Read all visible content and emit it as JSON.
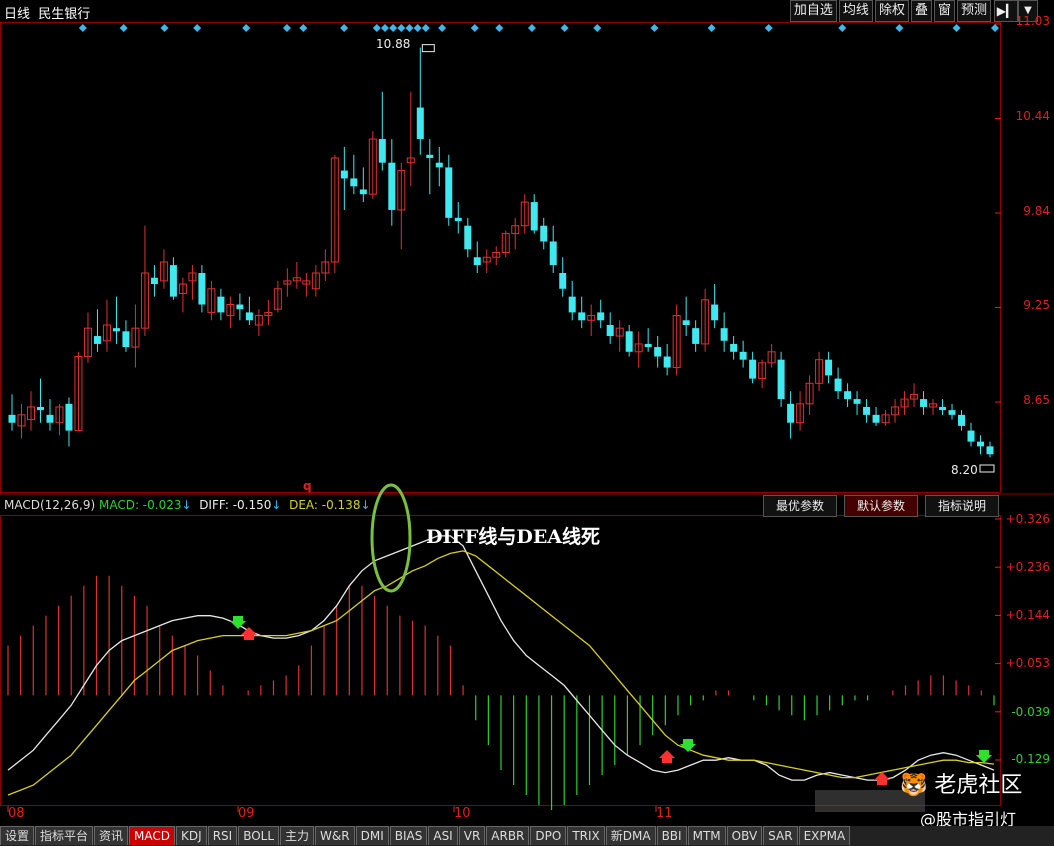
{
  "window": {
    "period": "日线",
    "stock_name": "民生银行"
  },
  "toolbar": {
    "buttons": [
      "加自选",
      "均线",
      "除权",
      "叠",
      "窗",
      "预测"
    ],
    "more_icon": "exit-icon",
    "dropdown_icon": "dropdown-arrow-icon"
  },
  "price_axis": [
    "11.03",
    "10.44",
    "9.84",
    "9.25",
    "8.65"
  ],
  "price_markers": {
    "high": "10.88",
    "low": "8.20"
  },
  "macd_panel": {
    "indicator": "MACD(12,26,9)",
    "macd_label": "MACD: -0.023",
    "diff_label": "DIFF: -0.150",
    "dea_label": "DEA: -0.138",
    "arrow_down": "↓",
    "param_tabs": [
      "最优参数",
      "默认参数",
      "指标说明"
    ],
    "active_param_tab": "默认参数",
    "axis": [
      "+0.326",
      "+0.236",
      "+0.144",
      "+0.053",
      "-0.039",
      "-0.129"
    ],
    "annotation": "DIFF线与DEA线死",
    "mark_q": "q"
  },
  "months": [
    "08",
    "09",
    "10",
    "11"
  ],
  "bottom_tabs": [
    "设置",
    "指标平台",
    "资讯",
    "MACD",
    "KDJ",
    "RSI",
    "BOLL",
    "主力",
    "W&R",
    "DMI",
    "BIAS",
    "ASI",
    "VR",
    "ARBR",
    "DPO",
    "TRIX",
    "新DMA",
    "BBI",
    "MTM",
    "OBV",
    "SAR",
    "EXPMA"
  ],
  "active_bottom_tab": "MACD",
  "watermark": {
    "brand": "老虎社区",
    "handle": "@股市指引灯"
  },
  "colors": {
    "up": "#e03030",
    "down": "#40e8f0",
    "diff_line": "#e8e8e8",
    "dea_line": "#d8d020",
    "axis_red": "#e02020",
    "signal_marker": "#3fb8e8",
    "hist_negative": "#30d030",
    "circle": "#7ac040"
  },
  "chart_data": [
    {
      "type": "candlestick",
      "title": "民生银行 日线",
      "ylim": [
        8.2,
        11.03
      ],
      "high_label": 10.88,
      "low_label": 8.2,
      "candles": [
        [
          8.55,
          8.68,
          8.45,
          8.5
        ],
        [
          8.48,
          8.62,
          8.4,
          8.55
        ],
        [
          8.52,
          8.7,
          8.45,
          8.6
        ],
        [
          8.6,
          8.78,
          8.5,
          8.58
        ],
        [
          8.55,
          8.65,
          8.45,
          8.5
        ],
        [
          8.5,
          8.62,
          8.42,
          8.6
        ],
        [
          8.62,
          8.66,
          8.35,
          8.45
        ],
        [
          8.45,
          8.95,
          8.45,
          8.92
        ],
        [
          8.92,
          9.2,
          8.88,
          9.1
        ],
        [
          9.05,
          9.22,
          8.95,
          9.0
        ],
        [
          9.02,
          9.28,
          8.95,
          9.12
        ],
        [
          9.1,
          9.3,
          9.0,
          9.08
        ],
        [
          9.08,
          9.15,
          8.95,
          8.98
        ],
        [
          8.98,
          9.25,
          8.85,
          9.1
        ],
        [
          9.1,
          9.75,
          9.05,
          9.45
        ],
        [
          9.42,
          9.5,
          9.3,
          9.38
        ],
        [
          9.4,
          9.6,
          9.35,
          9.52
        ],
        [
          9.5,
          9.55,
          9.28,
          9.3
        ],
        [
          9.32,
          9.42,
          9.2,
          9.38
        ],
        [
          9.4,
          9.5,
          9.28,
          9.45
        ],
        [
          9.45,
          9.5,
          9.2,
          9.25
        ],
        [
          9.2,
          9.4,
          9.15,
          9.35
        ],
        [
          9.3,
          9.35,
          9.15,
          9.2
        ],
        [
          9.18,
          9.3,
          9.1,
          9.25
        ],
        [
          9.25,
          9.32,
          9.15,
          9.22
        ],
        [
          9.2,
          9.3,
          9.12,
          9.15
        ],
        [
          9.12,
          9.22,
          9.05,
          9.18
        ],
        [
          9.18,
          9.28,
          9.12,
          9.2
        ],
        [
          9.22,
          9.4,
          9.2,
          9.35
        ],
        [
          9.38,
          9.48,
          9.3,
          9.4
        ],
        [
          9.4,
          9.52,
          9.35,
          9.42
        ],
        [
          9.38,
          9.45,
          9.3,
          9.4
        ],
        [
          9.35,
          9.5,
          9.3,
          9.45
        ],
        [
          9.45,
          9.6,
          9.4,
          9.52
        ],
        [
          9.52,
          10.2,
          9.45,
          10.18
        ],
        [
          10.1,
          10.25,
          9.85,
          10.05
        ],
        [
          10.05,
          10.2,
          9.95,
          10.0
        ],
        [
          9.98,
          10.12,
          9.9,
          9.95
        ],
        [
          9.95,
          10.35,
          9.92,
          10.3
        ],
        [
          10.3,
          10.6,
          10.1,
          10.15
        ],
        [
          10.15,
          10.3,
          9.75,
          9.85
        ],
        [
          9.85,
          10.15,
          9.6,
          10.1
        ],
        [
          10.15,
          10.6,
          10.0,
          10.18
        ],
        [
          10.5,
          10.88,
          10.2,
          10.3
        ],
        [
          10.2,
          10.3,
          9.95,
          10.18
        ],
        [
          10.15,
          10.25,
          10.0,
          10.12
        ],
        [
          10.12,
          10.2,
          9.75,
          9.8
        ],
        [
          9.8,
          9.9,
          9.7,
          9.78
        ],
        [
          9.75,
          9.8,
          9.55,
          9.6
        ],
        [
          9.55,
          9.65,
          9.45,
          9.5
        ],
        [
          9.52,
          9.6,
          9.45,
          9.55
        ],
        [
          9.55,
          9.62,
          9.5,
          9.58
        ],
        [
          9.58,
          9.72,
          9.55,
          9.7
        ],
        [
          9.7,
          9.8,
          9.6,
          9.75
        ],
        [
          9.75,
          9.95,
          9.7,
          9.9
        ],
        [
          9.9,
          9.95,
          9.7,
          9.72
        ],
        [
          9.75,
          9.8,
          9.6,
          9.65
        ],
        [
          9.65,
          9.75,
          9.45,
          9.5
        ],
        [
          9.45,
          9.55,
          9.3,
          9.35
        ],
        [
          9.3,
          9.4,
          9.15,
          9.2
        ],
        [
          9.2,
          9.3,
          9.1,
          9.15
        ],
        [
          9.15,
          9.25,
          9.05,
          9.18
        ],
        [
          9.2,
          9.28,
          9.1,
          9.15
        ],
        [
          9.12,
          9.2,
          9.0,
          9.05
        ],
        [
          9.05,
          9.15,
          8.95,
          9.1
        ],
        [
          9.08,
          9.12,
          8.92,
          8.95
        ],
        [
          8.95,
          9.08,
          8.85,
          9.0
        ],
        [
          9.0,
          9.1,
          8.95,
          8.98
        ],
        [
          8.98,
          9.05,
          8.85,
          8.92
        ],
        [
          8.92,
          9.0,
          8.8,
          8.85
        ],
        [
          8.85,
          9.25,
          8.8,
          9.18
        ],
        [
          9.15,
          9.3,
          9.05,
          9.12
        ],
        [
          9.1,
          9.15,
          8.95,
          9.0
        ],
        [
          9.0,
          9.35,
          8.95,
          9.28
        ],
        [
          9.25,
          9.38,
          9.1,
          9.15
        ],
        [
          9.1,
          9.2,
          8.95,
          9.02
        ],
        [
          9.0,
          9.05,
          8.9,
          8.95
        ],
        [
          8.95,
          9.02,
          8.85,
          8.9
        ],
        [
          8.9,
          8.95,
          8.75,
          8.78
        ],
        [
          8.78,
          8.9,
          8.72,
          8.88
        ],
        [
          8.88,
          9.0,
          8.85,
          8.95
        ],
        [
          8.9,
          8.95,
          8.6,
          8.65
        ],
        [
          8.62,
          8.7,
          8.4,
          8.5
        ],
        [
          8.5,
          8.7,
          8.45,
          8.62
        ],
        [
          8.62,
          8.8,
          8.55,
          8.75
        ],
        [
          8.75,
          8.95,
          8.7,
          8.9
        ],
        [
          8.9,
          8.95,
          8.75,
          8.8
        ],
        [
          8.78,
          8.85,
          8.65,
          8.7
        ],
        [
          8.7,
          8.75,
          8.6,
          8.65
        ],
        [
          8.65,
          8.7,
          8.55,
          8.62
        ],
        [
          8.6,
          8.65,
          8.5,
          8.55
        ],
        [
          8.55,
          8.6,
          8.48,
          8.5
        ],
        [
          8.5,
          8.58,
          8.48,
          8.55
        ],
        [
          8.55,
          8.65,
          8.5,
          8.6
        ],
        [
          8.6,
          8.7,
          8.55,
          8.65
        ],
        [
          8.65,
          8.75,
          8.6,
          8.68
        ],
        [
          8.65,
          8.7,
          8.55,
          8.6
        ],
        [
          8.6,
          8.65,
          8.55,
          8.62
        ],
        [
          8.6,
          8.65,
          8.55,
          8.58
        ],
        [
          8.58,
          8.62,
          8.52,
          8.55
        ],
        [
          8.55,
          8.58,
          8.45,
          8.48
        ],
        [
          8.45,
          8.5,
          8.35,
          8.38
        ],
        [
          8.38,
          8.42,
          8.3,
          8.35
        ],
        [
          8.35,
          8.38,
          8.28,
          8.3
        ]
      ],
      "signal_markers_top": [
        5,
        10,
        15,
        19,
        25,
        30,
        32,
        37,
        41,
        42,
        43,
        44,
        45,
        46,
        47,
        49,
        53,
        56,
        60,
        64,
        68,
        75,
        82,
        89,
        98,
        105,
        112
      ]
    },
    {
      "type": "line",
      "title": "MACD(12,26,9)",
      "ylim": [
        -0.22,
        0.36
      ],
      "axis_ticks": [
        0.326,
        0.236,
        0.144,
        0.053,
        -0.039,
        -0.129
      ],
      "series": [
        {
          "name": "DIFF",
          "values": [
            -0.15,
            -0.13,
            -0.11,
            -0.08,
            -0.05,
            -0.02,
            0.02,
            0.06,
            0.09,
            0.11,
            0.12,
            0.13,
            0.14,
            0.15,
            0.155,
            0.16,
            0.16,
            0.155,
            0.145,
            0.13,
            0.12,
            0.115,
            0.115,
            0.12,
            0.13,
            0.15,
            0.18,
            0.22,
            0.25,
            0.27,
            0.28,
            0.29,
            0.3,
            0.31,
            0.32,
            0.32,
            0.3,
            0.25,
            0.2,
            0.15,
            0.11,
            0.08,
            0.06,
            0.04,
            0.02,
            -0.01,
            -0.04,
            -0.07,
            -0.1,
            -0.12,
            -0.135,
            -0.15,
            -0.155,
            -0.15,
            -0.14,
            -0.13,
            -0.13,
            -0.125,
            -0.13,
            -0.13,
            -0.14,
            -0.16,
            -0.17,
            -0.17,
            -0.16,
            -0.155,
            -0.16,
            -0.165,
            -0.17,
            -0.17,
            -0.165,
            -0.15,
            -0.13,
            -0.12,
            -0.115,
            -0.12,
            -0.13,
            -0.14,
            -0.15
          ]
        },
        {
          "name": "DEA",
          "values": [
            -0.2,
            -0.19,
            -0.18,
            -0.16,
            -0.14,
            -0.12,
            -0.09,
            -0.06,
            -0.03,
            0.0,
            0.03,
            0.05,
            0.07,
            0.09,
            0.1,
            0.11,
            0.115,
            0.12,
            0.12,
            0.12,
            0.12,
            0.12,
            0.12,
            0.125,
            0.13,
            0.14,
            0.15,
            0.17,
            0.19,
            0.21,
            0.22,
            0.235,
            0.25,
            0.26,
            0.275,
            0.285,
            0.29,
            0.28,
            0.26,
            0.24,
            0.22,
            0.2,
            0.18,
            0.16,
            0.14,
            0.12,
            0.1,
            0.07,
            0.04,
            0.01,
            -0.02,
            -0.05,
            -0.08,
            -0.1,
            -0.11,
            -0.12,
            -0.125,
            -0.13,
            -0.13,
            -0.13,
            -0.135,
            -0.14,
            -0.145,
            -0.15,
            -0.155,
            -0.16,
            -0.165,
            -0.165,
            -0.16,
            -0.155,
            -0.15,
            -0.145,
            -0.14,
            -0.135,
            -0.13,
            -0.13,
            -0.135,
            -0.135,
            -0.138
          ]
        }
      ],
      "histogram": [
        0.1,
        0.12,
        0.14,
        0.16,
        0.18,
        0.2,
        0.22,
        0.24,
        0.24,
        0.22,
        0.2,
        0.18,
        0.14,
        0.12,
        0.1,
        0.08,
        0.05,
        0.02,
        0.0,
        0.01,
        0.02,
        0.03,
        0.04,
        0.06,
        0.1,
        0.14,
        0.18,
        0.22,
        0.22,
        0.2,
        0.18,
        0.16,
        0.15,
        0.14,
        0.12,
        0.1,
        0.02,
        -0.05,
        -0.1,
        -0.15,
        -0.18,
        -0.2,
        -0.22,
        -0.23,
        -0.22,
        -0.2,
        -0.18,
        -0.16,
        -0.14,
        -0.12,
        -0.1,
        -0.08,
        -0.06,
        -0.04,
        -0.02,
        -0.01,
        0.01,
        0.01,
        0.0,
        -0.01,
        -0.02,
        -0.03,
        -0.04,
        -0.05,
        -0.04,
        -0.03,
        -0.02,
        -0.01,
        -0.01,
        0.0,
        0.01,
        0.02,
        0.03,
        0.04,
        0.04,
        0.03,
        0.02,
        0.01,
        -0.02
      ]
    }
  ]
}
